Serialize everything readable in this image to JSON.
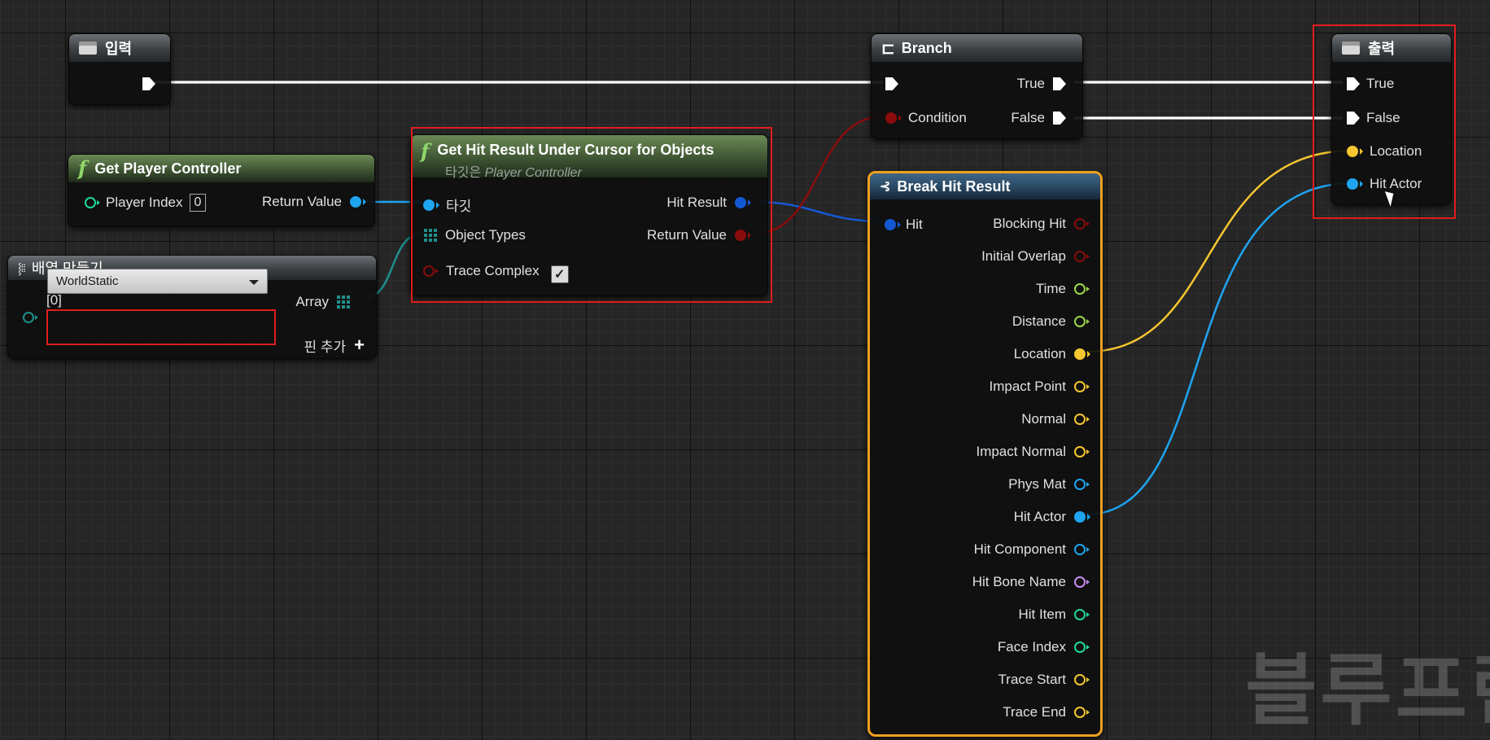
{
  "colors": {
    "exec": "#ffffff",
    "object_pin": "#1fa4f0",
    "struct_pin": "#1458d4",
    "bool_pin": "#8a0c0c",
    "int_pin": "#1fd8a0",
    "float_pin": "#9cd84a",
    "vector_pin": "#f5c630",
    "name_pin": "#c98cf0",
    "array_pin": "#1f8f8c",
    "highlight": "#e01d1d",
    "selected_border": "#f0a020"
  },
  "input_node": {
    "title": "입력",
    "icon": "input-node-icon"
  },
  "player_controller_node": {
    "title": "Get Player Controller",
    "icon": "function-icon",
    "player_index_label": "Player Index",
    "player_index_value": "0",
    "return_label": "Return Value"
  },
  "make_array_node": {
    "title": "배열 만들기",
    "icon": "make-array-icon",
    "index_label": "[0]",
    "array_label": "Array",
    "dropdown_value": "WorldStatic",
    "add_pin_label": "핀 추가"
  },
  "hit_result_node": {
    "title": "Get Hit Result Under Cursor for Objects",
    "icon": "function-icon",
    "subtitle_prefix": "타깃은",
    "subtitle_target": "Player Controller",
    "target_label": "타깃",
    "object_types_label": "Object Types",
    "trace_complex_label": "Trace Complex",
    "trace_complex_checked": true,
    "hit_result_label": "Hit Result",
    "return_label": "Return Value"
  },
  "branch_node": {
    "title": "Branch",
    "icon": "branch-icon",
    "condition_label": "Condition",
    "true_label": "True",
    "false_label": "False"
  },
  "break_hit_node": {
    "title": "Break Hit Result",
    "icon": "break-struct-icon",
    "hit_label": "Hit",
    "outputs": [
      {
        "label": "Blocking Hit",
        "type": "bool",
        "connected": false
      },
      {
        "label": "Initial Overlap",
        "type": "bool",
        "connected": false
      },
      {
        "label": "Time",
        "type": "float",
        "connected": false
      },
      {
        "label": "Distance",
        "type": "float",
        "connected": false
      },
      {
        "label": "Location",
        "type": "vector",
        "connected": true
      },
      {
        "label": "Impact Point",
        "type": "vector",
        "connected": false
      },
      {
        "label": "Normal",
        "type": "vector",
        "connected": false
      },
      {
        "label": "Impact Normal",
        "type": "vector",
        "connected": false
      },
      {
        "label": "Phys Mat",
        "type": "object",
        "connected": false
      },
      {
        "label": "Hit Actor",
        "type": "object",
        "connected": true
      },
      {
        "label": "Hit Component",
        "type": "object",
        "connected": false
      },
      {
        "label": "Hit Bone Name",
        "type": "name",
        "connected": false
      },
      {
        "label": "Hit Item",
        "type": "int",
        "connected": false
      },
      {
        "label": "Face Index",
        "type": "int",
        "connected": false
      },
      {
        "label": "Trace Start",
        "type": "vector",
        "connected": false
      },
      {
        "label": "Trace End",
        "type": "vector",
        "connected": false
      }
    ]
  },
  "output_node": {
    "title": "출력",
    "icon": "output-node-icon",
    "true_label": "True",
    "false_label": "False",
    "location_label": "Location",
    "hit_actor_label": "Hit Actor"
  },
  "watermark": "블루프린"
}
